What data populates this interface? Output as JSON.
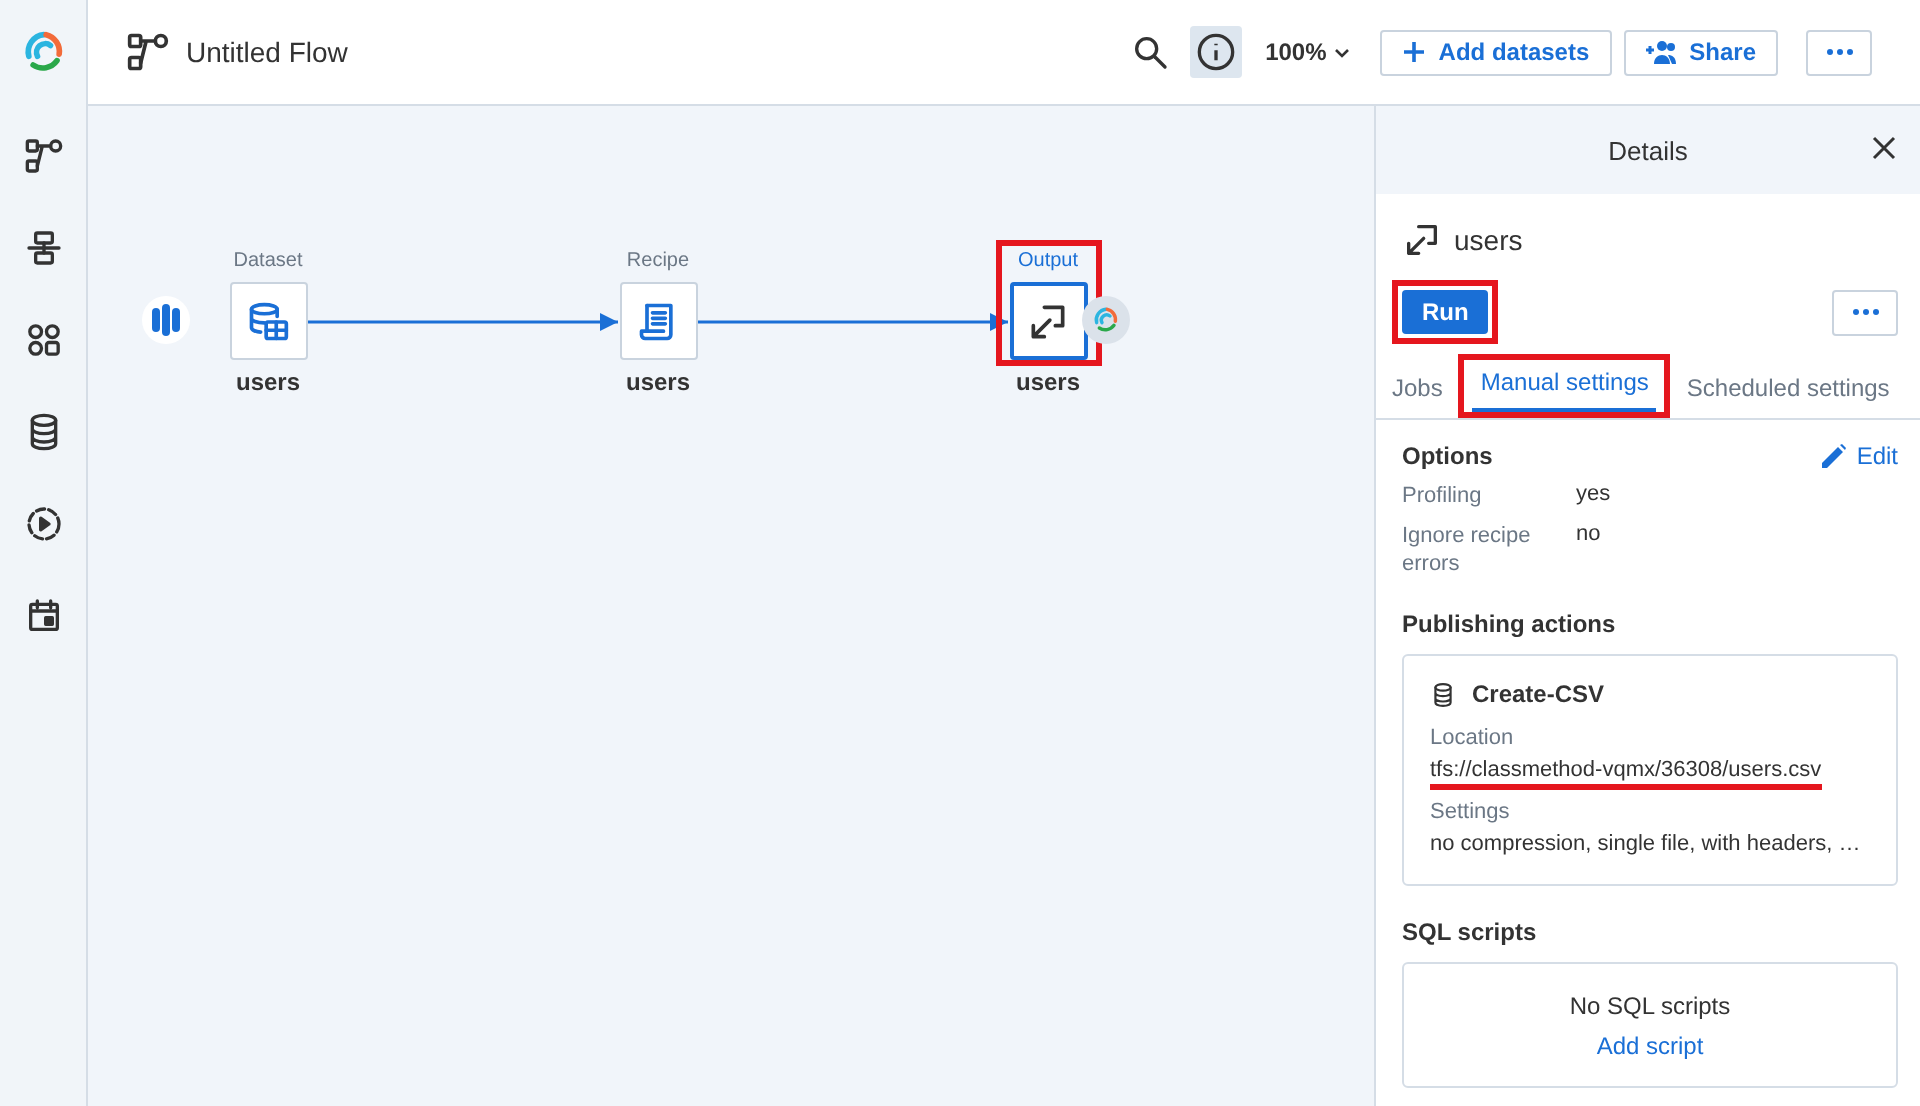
{
  "header": {
    "flow_title": "Untitled Flow",
    "info_selected": true,
    "zoom": "100%",
    "add_button": "Add datasets",
    "share_button": "Share"
  },
  "flow": {
    "nodes": [
      {
        "kind": "dataset",
        "label": "Dataset",
        "name": "users",
        "selected": false,
        "highlighted": false
      },
      {
        "kind": "recipe",
        "label": "Recipe",
        "name": "users",
        "selected": false,
        "highlighted": false
      },
      {
        "kind": "output",
        "label": "Output",
        "name": "users",
        "selected": true,
        "highlighted": true
      }
    ]
  },
  "details": {
    "title": "Details",
    "name": "users",
    "run": {
      "label": "Run",
      "highlighted": true
    },
    "tabs": [
      {
        "label": "Jobs",
        "selected": false,
        "highlighted": false
      },
      {
        "label": "Manual settings",
        "selected": true,
        "highlighted": true
      },
      {
        "label": "Scheduled settings",
        "selected": false,
        "highlighted": false
      }
    ],
    "options": {
      "title": "Options",
      "edit": "Edit",
      "rows": [
        {
          "label": "Profiling",
          "value": "yes"
        },
        {
          "label": "Ignore recipe errors",
          "value": "no"
        }
      ]
    },
    "publishing": {
      "title": "Publishing actions",
      "action": {
        "name": "Create-CSV",
        "location_label": "Location",
        "location": "tfs://classmethod-vqmx/36308/users.csv",
        "location_underlined": true,
        "settings_label": "Settings",
        "settings": "no compression, single file, with headers, …"
      }
    },
    "sql": {
      "title": "SQL scripts",
      "empty": "No SQL scripts",
      "add": "Add script"
    }
  }
}
